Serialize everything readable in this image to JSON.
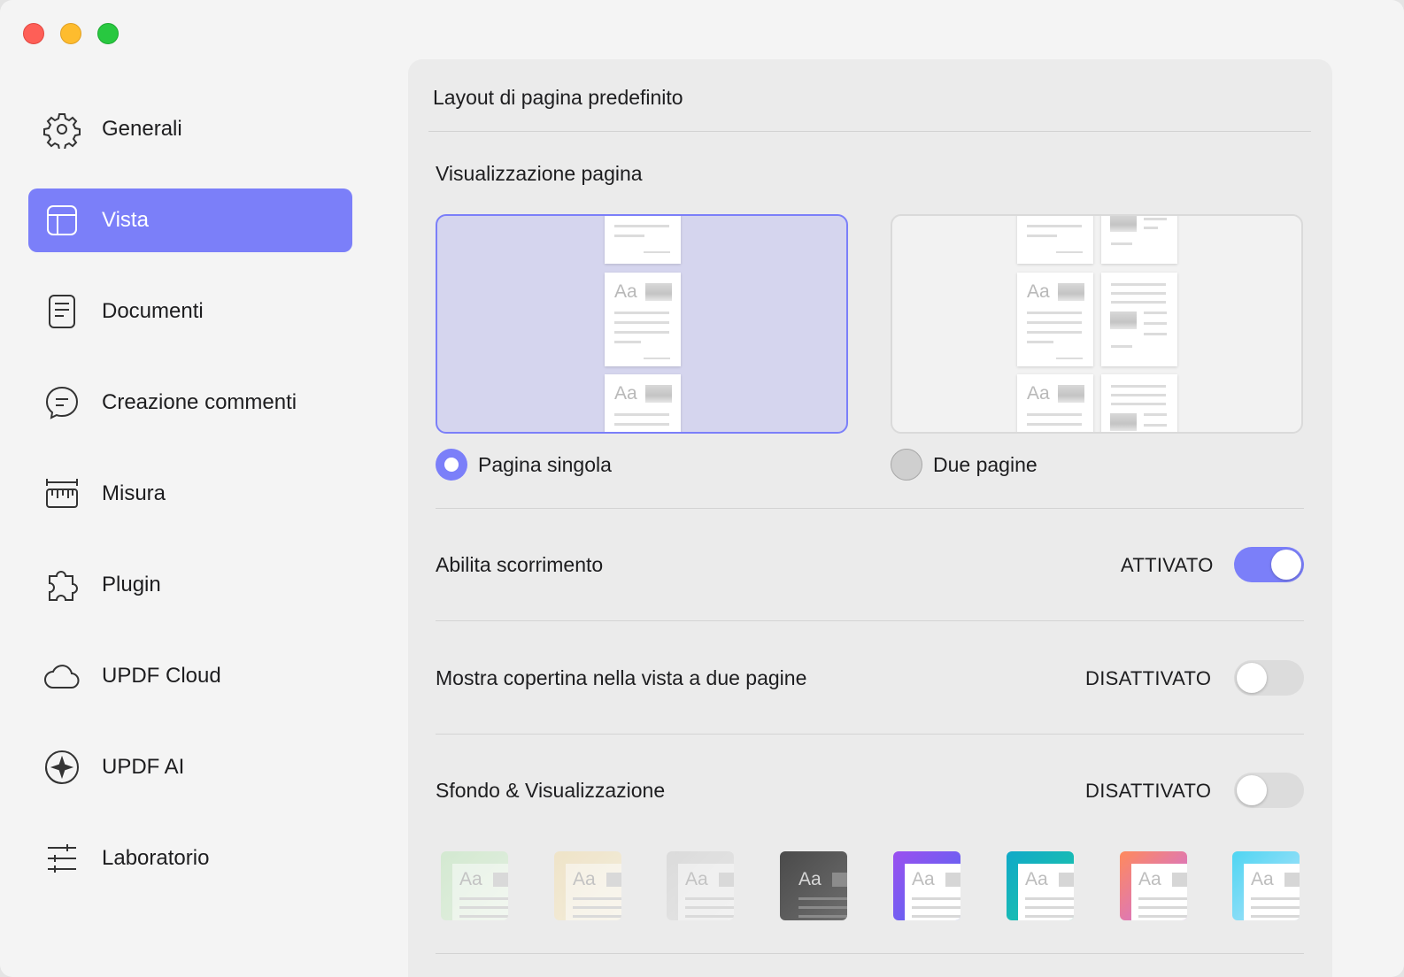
{
  "sidebar": {
    "items": [
      {
        "label": "Generali",
        "icon": "gear-icon"
      },
      {
        "label": "Vista",
        "icon": "layout-icon",
        "active": true
      },
      {
        "label": "Documenti",
        "icon": "document-icon"
      },
      {
        "label": "Creazione commenti",
        "icon": "comment-icon"
      },
      {
        "label": "Misura",
        "icon": "ruler-icon"
      },
      {
        "label": "Plugin",
        "icon": "puzzle-icon"
      },
      {
        "label": "UPDF Cloud",
        "icon": "cloud-icon"
      },
      {
        "label": "UPDF AI",
        "icon": "ai-icon"
      },
      {
        "label": "Laboratorio",
        "icon": "sliders-icon"
      }
    ]
  },
  "panel": {
    "title": "Layout di pagina predefinito",
    "page_view": {
      "label": "Visualizzazione pagina",
      "options": [
        {
          "label": "Pagina singola",
          "selected": true
        },
        {
          "label": "Due pagine",
          "selected": false
        }
      ],
      "thumb_text": "Aa"
    },
    "settings": [
      {
        "label": "Abilita scorrimento",
        "status": "ATTIVATO",
        "on": true
      },
      {
        "label": "Mostra copertina nella vista a due pagine",
        "status": "DISATTIVATO",
        "on": false
      },
      {
        "label": "Sfondo & Visualizzazione",
        "status": "DISATTIVATO",
        "on": false
      }
    ],
    "themes": [
      {
        "name": "green",
        "colors": [
          "#cfe8cc",
          "#e2f1df"
        ]
      },
      {
        "name": "beige",
        "colors": [
          "#efe2c2",
          "#f6eed9"
        ]
      },
      {
        "name": "light-gray",
        "colors": [
          "#d8d8d8",
          "#e6e6e6"
        ]
      },
      {
        "name": "dark",
        "colors": [
          "#4a4a4a",
          "#6e6e6e"
        ]
      },
      {
        "name": "purple-blue",
        "colors": [
          "#9b4ff0",
          "#4e6bf2"
        ]
      },
      {
        "name": "teal",
        "colors": [
          "#10a9c8",
          "#1fc9a5"
        ]
      },
      {
        "name": "sunset",
        "colors": [
          "#ff8a5c",
          "#c86cf0"
        ]
      },
      {
        "name": "sky",
        "colors": [
          "#4fd5f2",
          "#b7e4fb"
        ]
      }
    ]
  },
  "accent_color": "#7b7ff9"
}
